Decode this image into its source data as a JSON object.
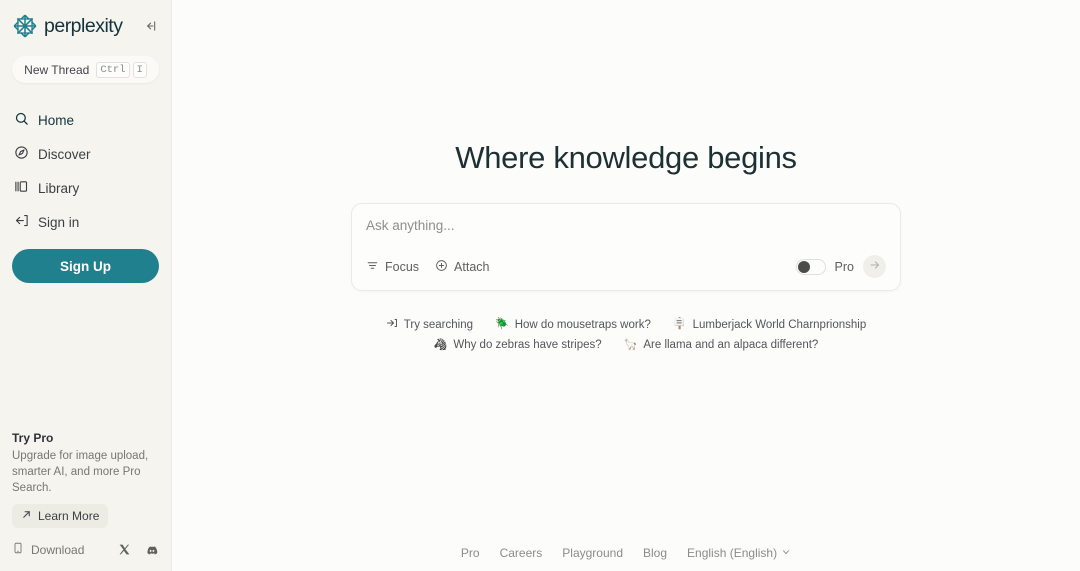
{
  "sidebar": {
    "brand": "perplexity",
    "collapse_icon": "collapse-sidebar-icon",
    "new_thread": {
      "label": "New Thread",
      "key_mod": "Ctrl",
      "key_char": "I"
    },
    "nav": [
      {
        "label": "Home",
        "icon": "search-icon",
        "active": true
      },
      {
        "label": "Discover",
        "icon": "compass-icon",
        "active": false
      },
      {
        "label": "Library",
        "icon": "library-icon",
        "active": false
      },
      {
        "label": "Sign in",
        "icon": "sign-in-icon",
        "active": false
      }
    ],
    "signup_label": "Sign Up",
    "try_pro": {
      "title": "Try Pro",
      "description": "Upgrade for image upload, smarter AI, and more Pro Search.",
      "cta": "Learn More",
      "cta_icon": "arrow-up-right-icon"
    },
    "footer": {
      "download_label": "Download",
      "download_icon": "phone-icon",
      "socials": [
        {
          "name": "x-twitter-icon"
        },
        {
          "name": "discord-icon"
        }
      ]
    },
    "accent_color": "#20808d",
    "background_color": "#f5f4ef"
  },
  "main": {
    "headline": "Where knowledge begins",
    "search": {
      "placeholder": "Ask anything...",
      "value": "",
      "focus_label": "Focus",
      "focus_icon": "filter-icon",
      "attach_label": "Attach",
      "attach_icon": "plus-circle-icon",
      "pro_label": "Pro",
      "pro_enabled": false,
      "submit_icon": "arrow-right-icon"
    },
    "suggestions": {
      "lead_label": "Try searching",
      "lead_icon": "arrow-enter-icon",
      "row1": [
        {
          "emoji": "🪲",
          "label": "How do mousetraps work?"
        },
        {
          "emoji": "🪧",
          "label": "Lumberjack World Charnprionship"
        }
      ],
      "row2": [
        {
          "emoji": "🦓",
          "label": "Why do zebras have stripes?"
        },
        {
          "emoji": "🦙",
          "label": "Are llama and an alpaca different?"
        }
      ]
    },
    "footer_links": [
      {
        "label": "Pro"
      },
      {
        "label": "Careers"
      },
      {
        "label": "Playground"
      },
      {
        "label": "Blog"
      },
      {
        "label": "English (English)",
        "has_chevron": true
      }
    ],
    "background_color": "#fcfcfa",
    "heading_color": "#1d3034"
  }
}
